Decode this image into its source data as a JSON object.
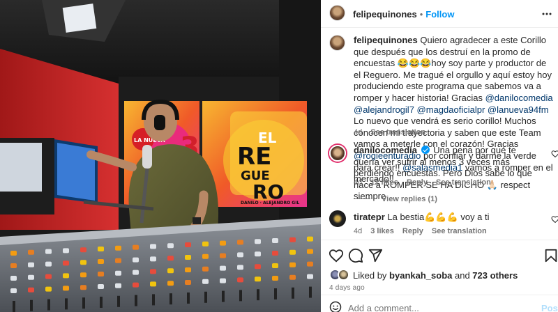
{
  "header": {
    "username": "felipequinones",
    "separator": "•",
    "follow_label": "Follow",
    "more_icon": "more-horizontal-icon"
  },
  "caption": {
    "username": "felipequinones",
    "text_1": " Quiero agradecer a este Corillo que después que los destruí en la promo de encuestas 😂😂😂hoy soy parte y productor de el Reguero. Me tragué el orgullo y aquí estoy hoy produciendo este programa que sabemos va a romper y hacer historia! Gracias ",
    "mention_1": "@danilocomedia",
    "mention_2": "@alejandrogil7",
    "mention_3": "@magdaoficialpr",
    "mention_4": "@lanueva94fm",
    "text_2": " Lo nuevo que vendrá es serio corillo! Muchos conocen mi trayectoria y saben que este Team vamos a meterle con el corazón! Gracias ",
    "mention_5": "@rogieenturadio",
    "text_3": " por confiar y darme la verde para crear!! ",
    "mention_6": "@salasmedia1",
    "text_4": " vamos a romper en el mercado!!",
    "time": "4d",
    "see_translation": "See translation"
  },
  "comments": [
    {
      "username": "danilocomedia",
      "verified": true,
      "text": " Una pena por qué te quería ver sufrir al menos 3 veces más perdiendo encuestas. Pero Dios sabe lo que hace a ROMPER SE HA DICHO 🙏🏻 respect siempre",
      "time": "4d",
      "likes": "12 likes",
      "reply": "Reply",
      "see_translation": "See translation",
      "view_replies": "View replies (1)"
    },
    {
      "username": "tiratepr",
      "text": " La bestia💪💪💪 voy a ti",
      "time": "4d",
      "likes": "3 likes",
      "reply": "Reply",
      "see_translation": "See translation"
    }
  ],
  "actions": {
    "like_icon": "heart-icon",
    "comment_icon": "comment-icon",
    "share_icon": "share-icon",
    "save_icon": "bookmark-icon"
  },
  "likes": {
    "prefix": "Liked by ",
    "user": "byankah_soba",
    "middle": " and ",
    "others": "723 others"
  },
  "post_time": "4 days ago",
  "add_comment": {
    "placeholder": "Add a comment...",
    "post_label": "Post",
    "emoji_icon": "emoji-icon"
  },
  "photo": {
    "screen_text_1": "EL",
    "screen_text_2": "RE",
    "screen_text_3": "GUE",
    "screen_text_4": "RO",
    "screen_subtitle": "DANILO · ALEJANDRO GIL"
  },
  "colors": {
    "accent_blue": "#0095f6",
    "link_blue": "#00376b",
    "studio_red": "#d42a2a",
    "muted_gray": "#737373"
  }
}
